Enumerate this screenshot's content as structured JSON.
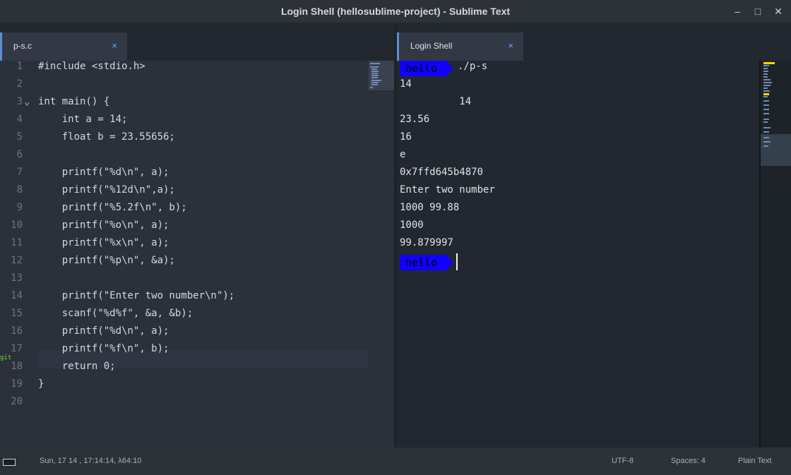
{
  "window": {
    "title": "Login Shell (hellosublime-project) - Sublime Text"
  },
  "controls": {
    "minimize": "–",
    "maximize": "□",
    "close": "✕"
  },
  "tabs": {
    "left": {
      "label": "p-s.c",
      "close": "×"
    },
    "right": {
      "label": "Login Shell",
      "close": "×"
    }
  },
  "editor": {
    "fold_icon": "⌄",
    "line_marker": "git",
    "lines": [
      {
        "n": "1",
        "text": "#include <stdio.h>"
      },
      {
        "n": "2",
        "text": ""
      },
      {
        "n": "3",
        "text": "int main() {"
      },
      {
        "n": "4",
        "text": "    int a = 14;"
      },
      {
        "n": "5",
        "text": "    float b = 23.55656;"
      },
      {
        "n": "6",
        "text": ""
      },
      {
        "n": "7",
        "text": "    printf(\"%d\\n\", a);"
      },
      {
        "n": "8",
        "text": "    printf(\"%12d\\n\",a);"
      },
      {
        "n": "9",
        "text": "    printf(\"%5.2f\\n\", b);"
      },
      {
        "n": "10",
        "text": "    printf(\"%o\\n\", a);"
      },
      {
        "n": "11",
        "text": "    printf(\"%x\\n\", a);"
      },
      {
        "n": "12",
        "text": "    printf(\"%p\\n\", &a);"
      },
      {
        "n": "13",
        "text": ""
      },
      {
        "n": "14",
        "text": "    printf(\"Enter two number\\n\");"
      },
      {
        "n": "15",
        "text": "    scanf(\"%d%f\", &a, &b);"
      },
      {
        "n": "16",
        "text": "    printf(\"%d\\n\", a);"
      },
      {
        "n": "17",
        "text": "    printf(\"%f\\n\", b);"
      },
      {
        "n": "18",
        "text": "    return 0;"
      },
      {
        "n": "19",
        "text": "}"
      },
      {
        "n": "20",
        "text": ""
      }
    ]
  },
  "terminal": {
    "prompt": "hello",
    "command": "./p-s",
    "output": [
      "14",
      "          14",
      "23.56",
      "16",
      "e",
      "0x7ffd645b4870",
      "Enter two number",
      "1000 99.88",
      "1000",
      "99.879997"
    ]
  },
  "status": {
    "clock": "Sun, 17 14  , 17:14:14, λ64:10",
    "encoding": "UTF-8",
    "indent": "Spaces: 4",
    "syntax": "Plain Text"
  },
  "colors": {
    "prompt_bg": "#1200ff",
    "tab_accent": "#5c8fd6",
    "close_accent": "#6aa2ff",
    "editor_bg": "#2b313a"
  }
}
